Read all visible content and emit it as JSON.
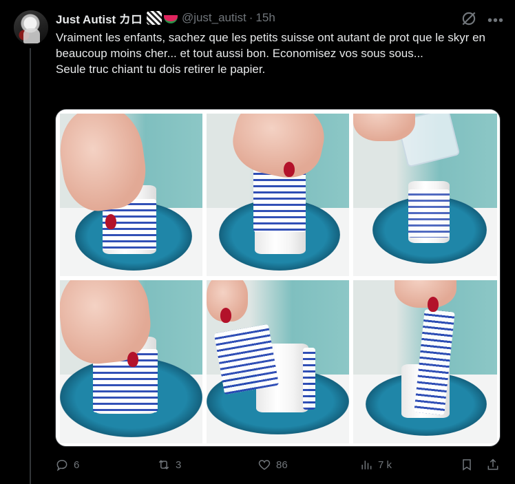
{
  "tweet": {
    "author_name": "Just Autist カロ",
    "handle": "@just_autist",
    "separator": "·",
    "time": "15h",
    "text_lines": [
      "Vraiment les enfants, sachez que les petits suisse ont autant de prot que le skyr en beaucoup moins cher... et tout aussi bon. Economisez vos sous sous...",
      "Seule truc chiant tu dois retirer le papier."
    ]
  },
  "actions": {
    "replies": "6",
    "reposts": "3",
    "likes": "86",
    "views": "7 k"
  },
  "icons": {
    "reply": "reply-icon",
    "repost": "repost-icon",
    "like": "heart-icon",
    "views": "views-icon",
    "bookmark": "bookmark-icon",
    "share": "share-icon",
    "grok": "grok-icon",
    "more": "more-icon"
  },
  "colors": {
    "background": "#000000",
    "text": "#e7e9ea",
    "muted": "#71767b",
    "border": "#2f3336"
  }
}
